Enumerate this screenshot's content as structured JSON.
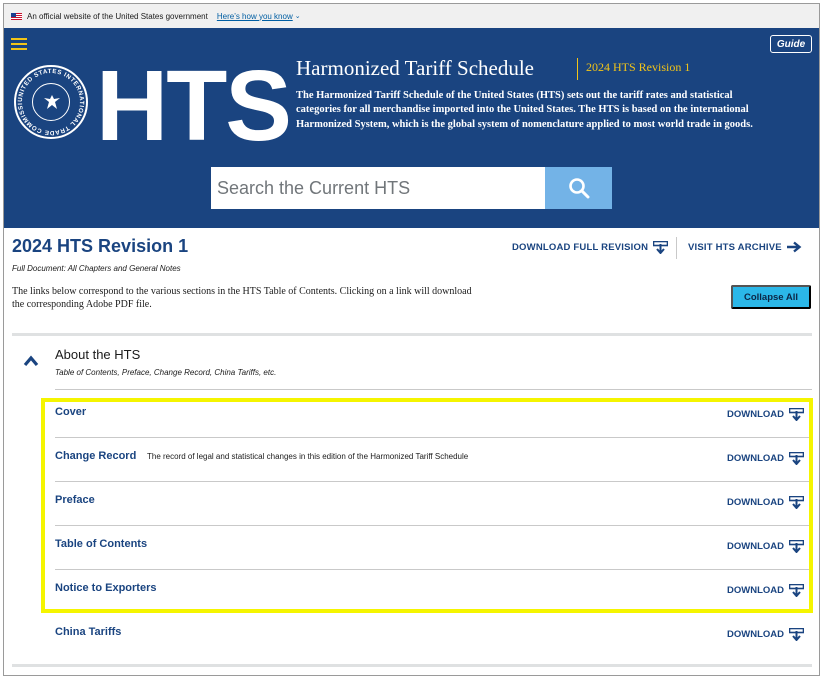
{
  "gov_banner": {
    "text": "An official website of the United States government",
    "link": "Here’s how you know"
  },
  "header": {
    "guide_label": "Guide",
    "logo_text": "HTS",
    "title": "Harmonized Tariff Schedule",
    "revision": "2024 HTS Revision 1",
    "description": "The Harmonized Tariff Schedule of the United States (HTS) sets out the tariff rates and statistical categories for all merchandise imported into the United States. The HTS is based on the international Harmonized System, which is the global system of nomenclature applied to most world trade in goods.",
    "seal_text": "UNITED STATES INTERNATIONAL TRADE COMMISSION",
    "search_placeholder": "Search the Current HTS"
  },
  "revision": {
    "title": "2024 HTS Revision 1",
    "subtitle": "Full Document: All Chapters and General Notes",
    "intro": "The links below correspond to the various sections in the HTS Table of Contents. Clicking on a link will download the corresponding Adobe PDF file.",
    "download_full": "DOWNLOAD FULL REVISION",
    "visit_archive": "VISIT HTS ARCHIVE",
    "collapse_all": "Collapse All"
  },
  "about": {
    "title": "About the HTS",
    "subtitle": "Table of Contents, Preface, Change Record, China Tariffs, etc.",
    "items": [
      {
        "label": "Cover",
        "desc": "",
        "download": "DOWNLOAD"
      },
      {
        "label": "Change Record",
        "desc": "The record of legal and statistical changes in this edition of the Harmonized Tariff Schedule",
        "download": "DOWNLOAD"
      },
      {
        "label": "Preface",
        "desc": "",
        "download": "DOWNLOAD"
      },
      {
        "label": "Table of Contents",
        "desc": "",
        "download": "DOWNLOAD"
      },
      {
        "label": "Notice to Exporters",
        "desc": "",
        "download": "DOWNLOAD"
      },
      {
        "label": "China Tariffs",
        "desc": "",
        "download": "DOWNLOAD"
      }
    ]
  },
  "colors": {
    "header_bg": "#1a4480",
    "accent_yellow": "#f2c418",
    "link_blue": "#1a4480",
    "collapse_btn": "#2bb7e8",
    "search_btn": "#73b3e7",
    "highlight": "#f5f500"
  }
}
